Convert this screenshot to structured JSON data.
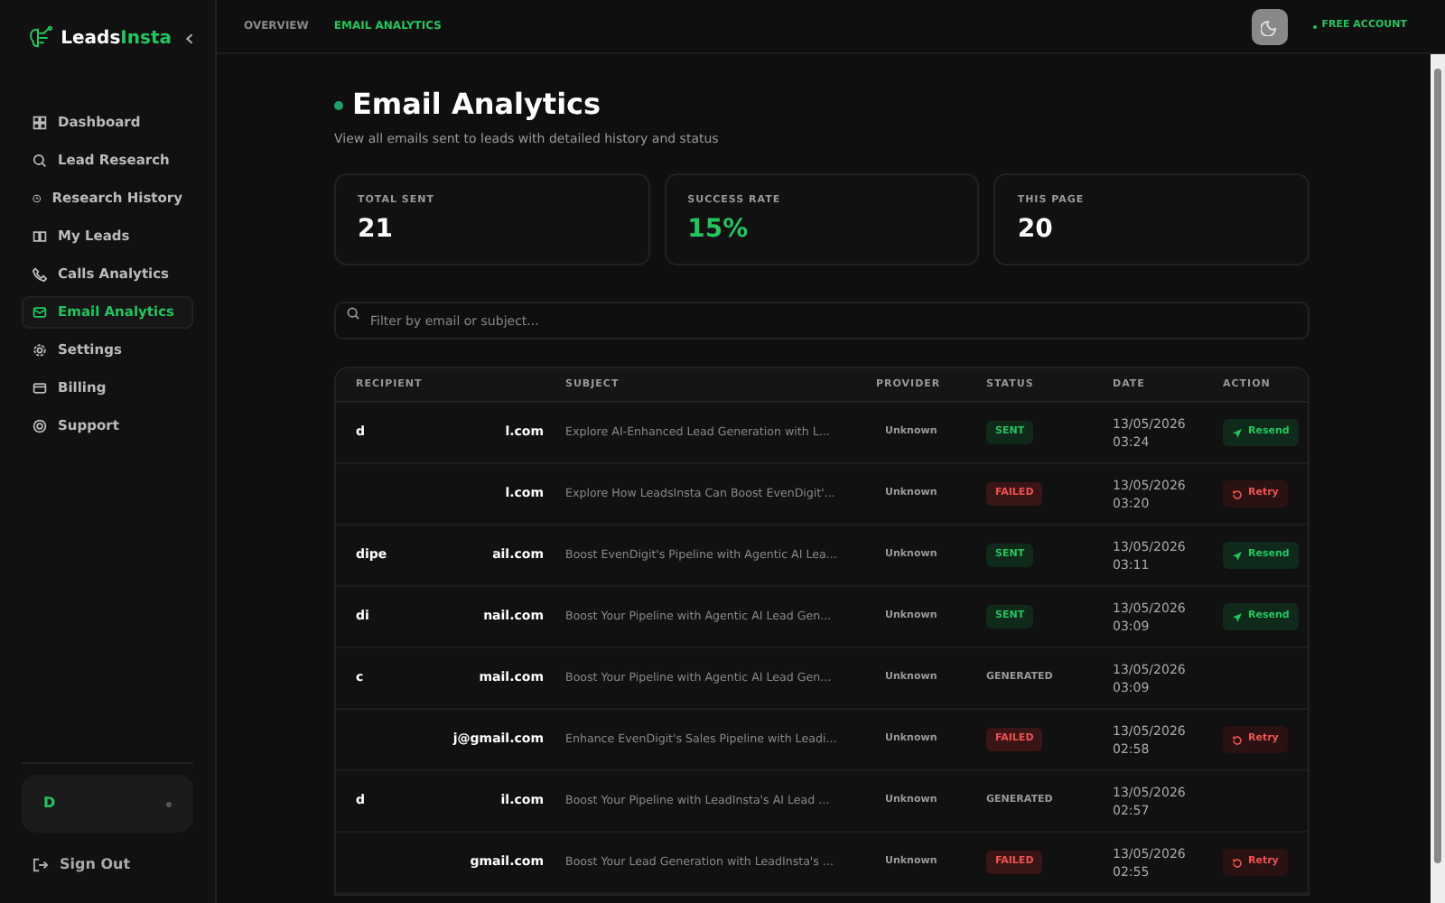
{
  "sidebar": {
    "brand": {
      "first": "Leads",
      "second": "Insta"
    },
    "items": [
      {
        "label": "Dashboard",
        "selected": false
      },
      {
        "label": "Lead Research",
        "selected": false
      },
      {
        "label": "Research History",
        "selected": false
      },
      {
        "label": "My Leads",
        "selected": false
      },
      {
        "label": "Calls Analytics",
        "selected": false
      },
      {
        "label": "Email Analytics",
        "selected": true
      },
      {
        "label": "Settings",
        "selected": false
      },
      {
        "label": "Billing",
        "selected": false
      },
      {
        "label": "Support",
        "selected": false
      }
    ],
    "account": {
      "initial": "D"
    },
    "sign_out": "Sign Out"
  },
  "topbar": {
    "breadcrumbs": [
      {
        "label": "OVERVIEW",
        "selected": false
      },
      {
        "label": "EMAIL ANALYTICS",
        "selected": true
      }
    ],
    "plan": "FREE ACCOUNT"
  },
  "page": {
    "title": "Email Analytics",
    "subtitle": "View all emails sent to leads with detailed history and status"
  },
  "stats": [
    {
      "label": "TOTAL SENT",
      "value": "21",
      "kind": "plain"
    },
    {
      "label": "SUCCESS RATE",
      "value": "15%",
      "kind": "positive"
    },
    {
      "label": "THIS PAGE",
      "value": "20",
      "kind": "plain"
    }
  ],
  "filter": {
    "placeholder": "Filter by email or subject..."
  },
  "table": {
    "columns": [
      "RECIPIENT",
      "SUBJECT",
      "PROVIDER",
      "STATUS",
      "DATE",
      "ACTION"
    ],
    "rows": [
      {
        "recipient_start": "d",
        "recipient_end": "l.com",
        "subject": "Explore AI-Enhanced Lead Generation with L...",
        "provider": "Unknown",
        "status": "SENT",
        "date": "13/05/2026",
        "time": "03:24",
        "action": "Resend"
      },
      {
        "recipient_start": "",
        "recipient_end": "l.com",
        "subject": "Explore How LeadsInsta Can Boost EvenDigit'...",
        "provider": "Unknown",
        "status": "FAILED",
        "date": "13/05/2026",
        "time": "03:20",
        "action": "Retry"
      },
      {
        "recipient_start": "dipe",
        "recipient_end": "ail.com",
        "subject": "Boost EvenDigit's Pipeline with Agentic AI Lea...",
        "provider": "Unknown",
        "status": "SENT",
        "date": "13/05/2026",
        "time": "03:11",
        "action": "Resend"
      },
      {
        "recipient_start": "di",
        "recipient_end": "nail.com",
        "subject": "Boost Your Pipeline with Agentic AI Lead Gen...",
        "provider": "Unknown",
        "status": "SENT",
        "date": "13/05/2026",
        "time": "03:09",
        "action": "Resend"
      },
      {
        "recipient_start": "c",
        "recipient_end": "mail.com",
        "subject": "Boost Your Pipeline with Agentic AI Lead Gen...",
        "provider": "Unknown",
        "status": "GENERATED",
        "date": "13/05/2026",
        "time": "03:09",
        "action": ""
      },
      {
        "recipient_start": "",
        "recipient_end": "j@gmail.com",
        "subject": "Enhance EvenDigit's Sales Pipeline with Leadi...",
        "provider": "Unknown",
        "status": "FAILED",
        "date": "13/05/2026",
        "time": "02:58",
        "action": "Retry"
      },
      {
        "recipient_start": "d",
        "recipient_end": "il.com",
        "subject": "Boost Your Pipeline with LeadInsta's AI Lead ...",
        "provider": "Unknown",
        "status": "GENERATED",
        "date": "13/05/2026",
        "time": "02:57",
        "action": ""
      },
      {
        "recipient_start": "",
        "recipient_end": "gmail.com",
        "subject": "Boost Your Lead Generation with LeadInsta's ...",
        "provider": "Unknown",
        "status": "FAILED",
        "date": "13/05/2026",
        "time": "02:55",
        "action": "Retry"
      }
    ]
  }
}
